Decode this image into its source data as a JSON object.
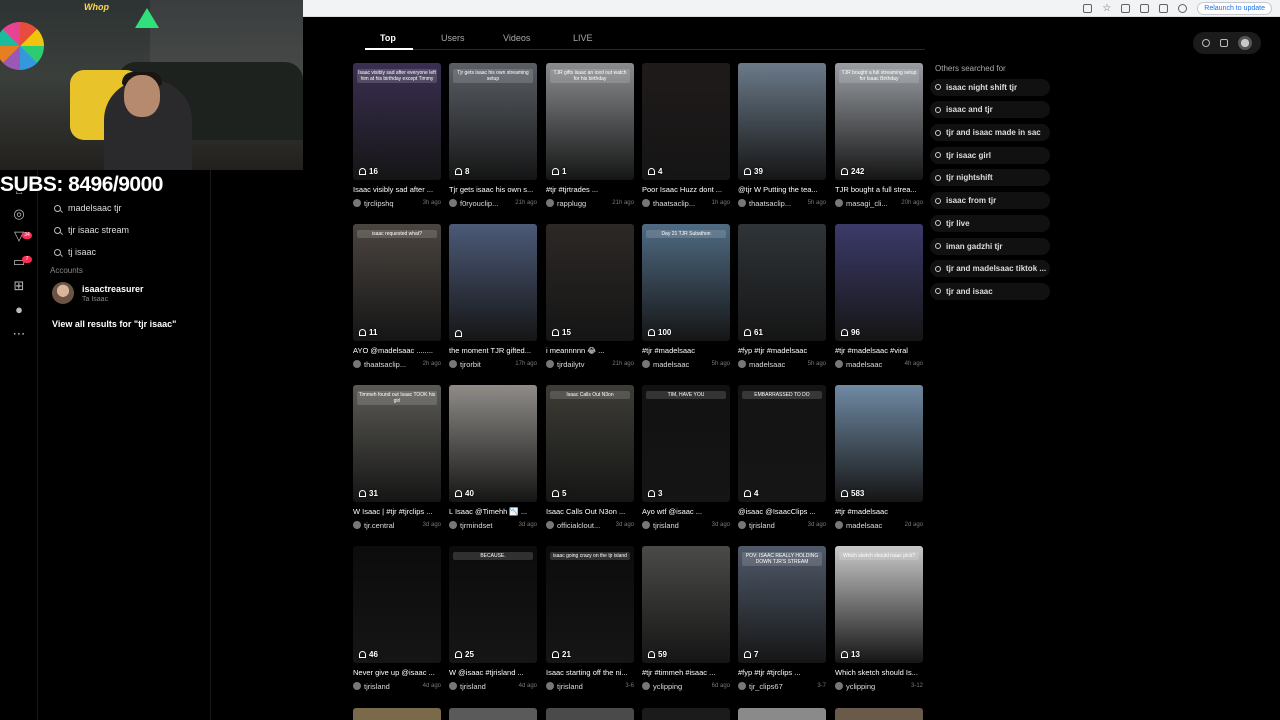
{
  "browser": {
    "relaunch_label": "Relaunch to update"
  },
  "stream_overlay": {
    "subs_goal": "SUBS: 8496/9000",
    "sponsor": "Whop"
  },
  "left_nav": {
    "badges": [
      "34",
      "7"
    ]
  },
  "search_panel": {
    "suggestions": [
      "madelsaac tjr",
      "tjr isaac stream",
      "tj isaac"
    ],
    "accounts_heading": "Accounts",
    "account_name": "isaactreasurer",
    "account_sub": "Ta Isaac",
    "view_all": "View all results for \"tjr isaac\""
  },
  "tabs": [
    {
      "label": "Top",
      "active": true
    },
    {
      "label": "Users",
      "active": false
    },
    {
      "label": "Videos",
      "active": false
    },
    {
      "label": "LIVE",
      "active": false
    }
  ],
  "videos": [
    {
      "likes": "16",
      "caption": "Isaac visibly sad after ...",
      "author": "tjrclipshq",
      "when": "3h ago",
      "bg": "#3a2f52",
      "thumb_text": "Isaac visibly sad after everyone left him at his birthday except Timmy"
    },
    {
      "likes": "8",
      "caption": "Tjr gets isaac his own s...",
      "author": "f0ryouclip...",
      "when": "21h ago",
      "bg": "#5a5f66",
      "thumb_text": "Tjr gets isaac his own streaming setup"
    },
    {
      "likes": "1",
      "caption": "#tjr #tjrtrades ...",
      "author": "rapplugg",
      "when": "21h ago",
      "bg": "#8a8c8e",
      "thumb_text": "TJR gifts isaac an iced out watch for his birthday"
    },
    {
      "likes": "4",
      "caption": "Poor Isaac Huzz dont ...",
      "author": "thaatsaclip...",
      "when": "1h ago",
      "bg": "#1f1b1a",
      "thumb_text": ""
    },
    {
      "likes": "39",
      "caption": "@tjr W Putting the tea...",
      "author": "thaatsaclip...",
      "when": "5h ago",
      "bg": "#6b7a8a",
      "thumb_text": ""
    },
    {
      "likes": "242",
      "caption": "TJR bought a full strea...",
      "author": "masagi_cli...",
      "when": "20h ago",
      "bg": "#9a9ea3",
      "thumb_text": "TJR bought a full streaming setup for Isaac Birthday"
    },
    {
      "likes": "11",
      "caption": "AYO @madelsaac ........",
      "author": "thaatsaclip...",
      "when": "2h ago",
      "bg": "#4b4540",
      "thumb_text": "isaac requested what?"
    },
    {
      "likes": "",
      "caption": "the moment TJR gifted...",
      "author": "tjrorbit",
      "when": "17h ago",
      "bg": "#4c5a78",
      "thumb_text": ""
    },
    {
      "likes": "15",
      "caption": "i meannnnn 😂 ...",
      "author": "tjrdailytv",
      "when": "21h ago",
      "bg": "#2c2826",
      "thumb_text": ""
    },
    {
      "likes": "100",
      "caption": "#tjr #madelsaac",
      "author": "madelsaac",
      "when": "5h ago",
      "bg": "#4f6b83",
      "thumb_text": "Day 21 TJR Subathon"
    },
    {
      "likes": "61",
      "caption": "#fyp #tjr #madelsaac",
      "author": "madelsaac",
      "when": "5h ago",
      "bg": "#2f3438",
      "thumb_text": ""
    },
    {
      "likes": "96",
      "caption": "#tjr #madelsaac #viral",
      "author": "madelsaac",
      "when": "4h ago",
      "bg": "#3c3a6a",
      "thumb_text": ""
    },
    {
      "likes": "31",
      "caption": "W Isaac | #tjr #tjrclips ...",
      "author": "tjr.central",
      "when": "3d ago",
      "bg": "#5b5a55",
      "thumb_text": "Timmeh found out Isaac TOOK his girl"
    },
    {
      "likes": "40",
      "caption": "L Isaac @Timehh 📉 ...",
      "author": "tjrmindset",
      "when": "3d ago",
      "bg": "#8f8c88",
      "thumb_text": ""
    },
    {
      "likes": "5",
      "caption": "Isaac Calls Out N3on ...",
      "author": "officialclout...",
      "when": "3d ago",
      "bg": "#3d3c36",
      "thumb_text": "Isaac Calls Out N3on"
    },
    {
      "likes": "3",
      "caption": "Ayo wtf @isaac ...",
      "author": "tjrisland",
      "when": "3d ago",
      "bg": "#111111",
      "thumb_text": "TIM, HAVE YOU"
    },
    {
      "likes": "4",
      "caption": "@isaac @IsaacClips ...",
      "author": "tjrisland",
      "when": "3d ago",
      "bg": "#141414",
      "thumb_text": "EMBARRASSED TO DO"
    },
    {
      "likes": "583",
      "caption": "#tjr #madelsaac",
      "author": "madelsaac",
      "when": "2d ago",
      "bg": "#6f8aa3",
      "thumb_text": ""
    },
    {
      "likes": "46",
      "caption": "Never give up @isaac ...",
      "author": "tjrisland",
      "when": "4d ago",
      "bg": "#0c0c0c",
      "thumb_text": ""
    },
    {
      "likes": "25",
      "caption": "W @isaac #tjrisland ...",
      "author": "tjrisland",
      "when": "4d ago",
      "bg": "#0c0c0c",
      "thumb_text": "BECAUSE."
    },
    {
      "likes": "21",
      "caption": "Isaac starting off the ni...",
      "author": "tjrisland",
      "when": "3-6",
      "bg": "#0c0c0c",
      "thumb_text": "isaac going crazy on the tjr island"
    },
    {
      "likes": "59",
      "caption": "#tjr #timmeh #isaac ...",
      "author": "yclipping",
      "when": "6d ago",
      "bg": "#4a4a48",
      "thumb_text": ""
    },
    {
      "likes": "7",
      "caption": "#fyp #tjr #tjrclips ...",
      "author": "tjr_clips67",
      "when": "3-7",
      "bg": "#505a6a",
      "thumb_text": "POV: ISAAC REALLY HOLDING DOWN TJR'S STREAM"
    },
    {
      "likes": "13",
      "caption": "Which sketch should Is...",
      "author": "yclipping",
      "when": "3-12",
      "bg": "#c9c9c9",
      "thumb_text": "Which sketch should isaac pick?"
    }
  ],
  "others_searched": {
    "heading": "Others searched for",
    "items": [
      "isaac night shift tjr",
      "isaac and tjr",
      "tjr and isaac made in sac",
      "tjr isaac girl",
      "tjr nightshift",
      "isaac from tjr",
      "tjr live",
      "iman gadzhi tjr",
      "tjr and madelsaac tiktok ...",
      "tjr and isaac"
    ]
  },
  "colors": {
    "accent": "#fe2c55",
    "background": "#000000"
  }
}
